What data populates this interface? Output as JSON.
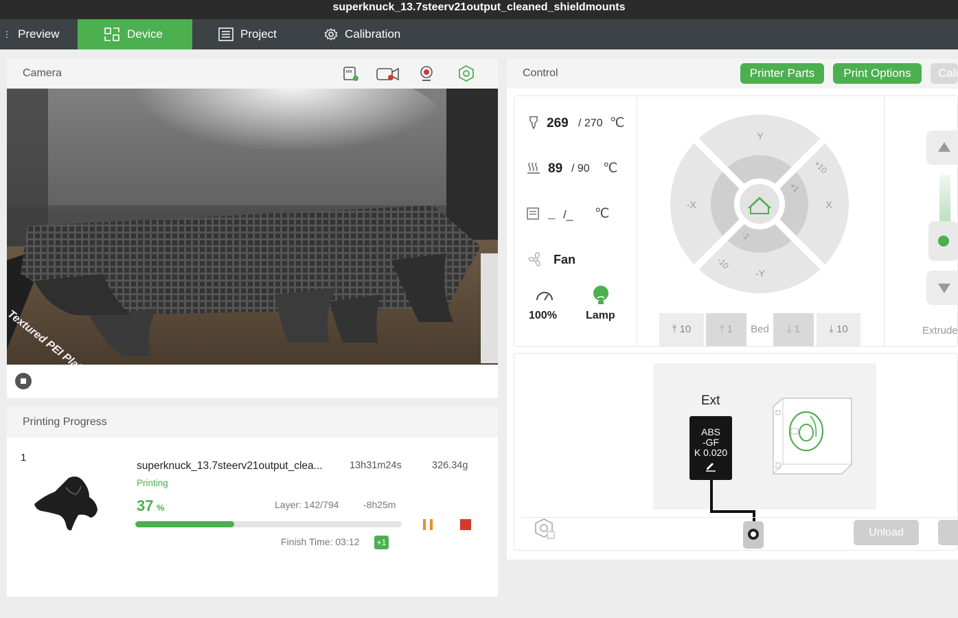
{
  "window": {
    "title": "superknuck_13.7steerv21output_cleaned_shieldmounts"
  },
  "tabs": [
    {
      "label": "Preview"
    },
    {
      "label": "Device"
    },
    {
      "label": "Project"
    },
    {
      "label": "Calibration"
    }
  ],
  "camera": {
    "title": "Camera",
    "plate_text": "Textured PEI Plate"
  },
  "progress": {
    "title": "Printing Progress",
    "plate_index": "1",
    "file_name": "superknuck_13.7steerv21output_clea...",
    "total_time": "13h31m24s",
    "weight": "326.34g",
    "status": "Printing",
    "percent": "37",
    "percent_unit": "%",
    "percent_fraction": 0.37,
    "layer": "Layer: 142/794",
    "remaining": "-8h25m",
    "finish_time": "Finish Time: 03:12",
    "finish_day_offset": "+1"
  },
  "control": {
    "title": "Control",
    "printer_parts": "Printer Parts",
    "print_options": "Print Options",
    "calibration_partial": "Cali",
    "nozzle": {
      "current": "269",
      "target": "/ 270",
      "unit": "℃"
    },
    "bed": {
      "current": "89",
      "target": "/ 90",
      "unit": "℃"
    },
    "chamber": {
      "current": "_",
      "target": "/_",
      "unit": "℃"
    },
    "fan_label": "Fan",
    "speed_value": "100%",
    "lamp_label": "Lamp",
    "jog": {
      "y_plus": "Y",
      "y_minus": "-Y",
      "x_plus": "X",
      "x_minus": "-X",
      "plus10": "+10",
      "plus1": "+1",
      "minus1": "-1",
      "minus10": "-10"
    },
    "bed_buttons": {
      "up10": "10",
      "up1": "1",
      "bed_label": "Bed",
      "down1": "1",
      "down10": "10"
    },
    "extruder_label": "Extrude"
  },
  "ams": {
    "ext_label": "Ext",
    "filament_line1": "ABS",
    "filament_line2": "-GF",
    "filament_k": "K 0.020",
    "unload": "Unload"
  }
}
